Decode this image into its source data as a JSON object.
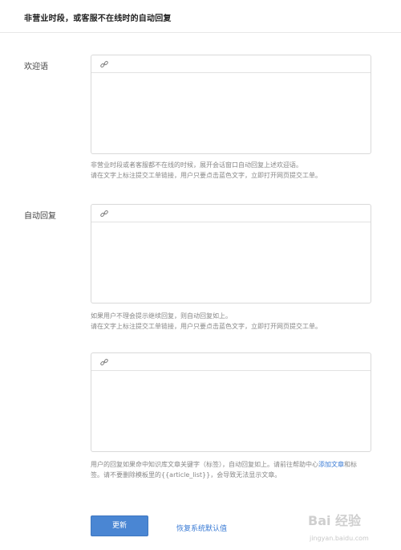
{
  "header": {
    "title": "非营业时段，或客服不在线时的自动回复"
  },
  "sections": [
    {
      "label": "欢迎语",
      "help_lines": [
        "非营业时段或者客服都不在线的时候，展开会话窗口自动回复上述欢迎语。",
        "请在文字上标注提交工单链接，用户只要点击蓝色文字，立即打开网页提交工单。"
      ]
    },
    {
      "label": "自动回复",
      "help_lines": [
        "如果用户不理会提示继续回复，则自动回复如上。",
        "请在文字上标注提交工单链接，用户只要点击蓝色文字，立即打开网页提交工单。"
      ]
    },
    {
      "label": "",
      "help_prefix": "用户的回复如果命中知识库文章关键字（标签），自动回复如上。请前往帮助中心",
      "help_link": "添加文章",
      "help_suffix": "和标签。请不要删除模板里的{{article_list}}，会导致无法显示文章。"
    }
  ],
  "actions": {
    "update_label": "更新",
    "restore_label": "恢复系统默认值"
  },
  "watermark": {
    "brand": "Bai 经验",
    "url": "jingyan.baidu.com"
  }
}
